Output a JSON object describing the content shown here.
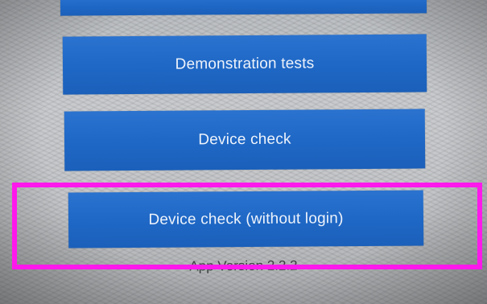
{
  "menu": {
    "buttons": [
      {
        "label": ""
      },
      {
        "label": "Demonstration tests"
      },
      {
        "label": "Device check"
      },
      {
        "label": "Device check (without login)"
      }
    ]
  },
  "footer": {
    "version": "App Version 2.2.2"
  },
  "colors": {
    "button_blue": "#1f68c6",
    "button_text": "#eef3fb",
    "highlight": "#ff18ec",
    "screen_background": "#c6c8cb"
  }
}
